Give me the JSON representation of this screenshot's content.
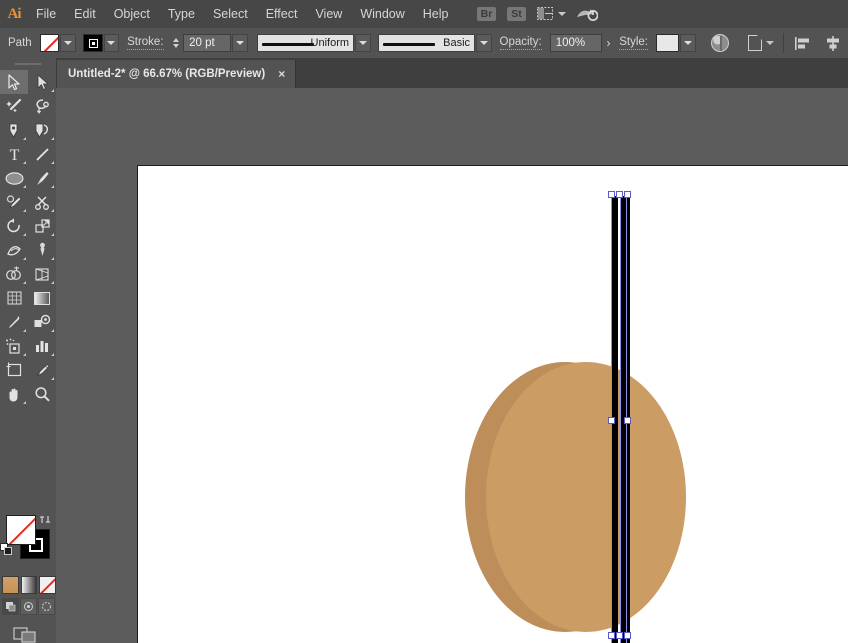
{
  "app": {
    "name": "Adobe Illustrator",
    "logo_text": "Ai"
  },
  "menubar": {
    "items": [
      {
        "label": "File",
        "name": "menu-file"
      },
      {
        "label": "Edit",
        "name": "menu-edit"
      },
      {
        "label": "Object",
        "name": "menu-object"
      },
      {
        "label": "Type",
        "name": "menu-type"
      },
      {
        "label": "Select",
        "name": "menu-select"
      },
      {
        "label": "Effect",
        "name": "menu-effect"
      },
      {
        "label": "View",
        "name": "menu-view"
      },
      {
        "label": "Window",
        "name": "menu-window"
      },
      {
        "label": "Help",
        "name": "menu-help"
      }
    ],
    "bridge_label": "Br",
    "stock_label": "St",
    "arrange_icon": "arrange-documents-icon",
    "sync_icon": "cloud-sync-icon"
  },
  "controlbar": {
    "selection_label": "Path",
    "fill_swatch": "none",
    "stroke_swatch": "black-square",
    "stroke_label": "Stroke:",
    "stroke_weight": "20 pt",
    "width_profile": "Uniform",
    "brush_definition": "Basic",
    "opacity_label": "Opacity:",
    "opacity_value": "100%",
    "style_label": "Style:",
    "style_swatch": "white",
    "recolor_icon": "recolor-artwork-icon",
    "transform_icon": "transform-icon",
    "align_left_icon": "align-horizontal-left-icon",
    "align_center_icon": "align-horizontal-center-icon"
  },
  "document": {
    "tab_title": "Untitled-2* @ 66.67% (RGB/Preview)",
    "close_label": "×",
    "zoom_level": "66.67%",
    "color_mode": "RGB",
    "view_mode": "Preview",
    "modified": true
  },
  "toolbar": {
    "tools": [
      {
        "name": "selection-tool",
        "label": "Selection Tool",
        "active": true,
        "corner": false
      },
      {
        "name": "direct-selection-tool",
        "label": "Direct Selection Tool",
        "active": false,
        "corner": true
      },
      {
        "name": "magic-wand-tool",
        "label": "Magic Wand Tool",
        "active": false,
        "corner": false
      },
      {
        "name": "lasso-tool",
        "label": "Lasso Tool",
        "active": false,
        "corner": false
      },
      {
        "name": "pen-tool",
        "label": "Pen Tool",
        "active": false,
        "corner": true
      },
      {
        "name": "curvature-tool",
        "label": "Curvature Tool",
        "active": false,
        "corner": true
      },
      {
        "name": "type-tool",
        "label": "Type Tool",
        "active": false,
        "corner": true
      },
      {
        "name": "line-segment-tool",
        "label": "Line Segment Tool",
        "active": false,
        "corner": true
      },
      {
        "name": "ellipse-tool",
        "label": "Ellipse Tool",
        "active": false,
        "corner": true
      },
      {
        "name": "paintbrush-tool",
        "label": "Paintbrush Tool",
        "active": false,
        "corner": true
      },
      {
        "name": "shaper-tool",
        "label": "Shaper Tool",
        "active": false,
        "corner": true
      },
      {
        "name": "scissors-tool",
        "label": "Scissors Tool",
        "active": false,
        "corner": true
      },
      {
        "name": "rotate-tool",
        "label": "Rotate Tool",
        "active": false,
        "corner": true
      },
      {
        "name": "scale-tool",
        "label": "Scale Tool",
        "active": false,
        "corner": true
      },
      {
        "name": "width-tool",
        "label": "Width Tool",
        "active": false,
        "corner": true
      },
      {
        "name": "free-transform-tool",
        "label": "Puppet Warp Tool",
        "active": false,
        "corner": true
      },
      {
        "name": "shape-builder-tool",
        "label": "Shape Builder Tool",
        "active": false,
        "corner": true
      },
      {
        "name": "perspective-grid-tool",
        "label": "Perspective Grid Tool",
        "active": false,
        "corner": true
      },
      {
        "name": "mesh-tool",
        "label": "Mesh Tool",
        "active": false,
        "corner": false
      },
      {
        "name": "gradient-tool",
        "label": "Gradient Tool",
        "active": false,
        "corner": false
      },
      {
        "name": "eyedropper-tool",
        "label": "Eyedropper Tool",
        "active": false,
        "corner": true
      },
      {
        "name": "blend-tool",
        "label": "Blend Tool",
        "active": false,
        "corner": true
      },
      {
        "name": "symbol-sprayer-tool",
        "label": "Symbol Sprayer Tool",
        "active": false,
        "corner": true
      },
      {
        "name": "column-graph-tool",
        "label": "Column Graph Tool",
        "active": false,
        "corner": true
      },
      {
        "name": "artboard-tool",
        "label": "Artboard Tool",
        "active": false,
        "corner": false
      },
      {
        "name": "slice-tool",
        "label": "Slice Tool",
        "active": false,
        "corner": true
      },
      {
        "name": "hand-tool",
        "label": "Hand Tool",
        "active": false,
        "corner": true
      },
      {
        "name": "zoom-tool",
        "label": "Zoom Tool",
        "active": false,
        "corner": false
      }
    ],
    "fill_label": "Fill: None",
    "stroke_label": "Stroke: Black",
    "swap_label": "Swap Fill and Stroke",
    "default_label": "Default Fill and Stroke",
    "color_mode_label": "Color",
    "gradient_mode_label": "Gradient",
    "none_mode_label": "None",
    "draw_normal_label": "Draw Normal",
    "draw_behind_label": "Draw Behind",
    "draw_inside_label": "Draw Inside",
    "screen_mode_label": "Change Screen Mode"
  },
  "artwork": {
    "ellipse_fill": "#cb9c64",
    "ellipse_shadow_fill": "#bd8e59",
    "path_stroke": "#000000",
    "selection_color": "#8f8fe8",
    "anchor_fill": "#ffffff",
    "selected_object": "Path",
    "objects": [
      {
        "name": "ellipse-shape",
        "type": "ellipse",
        "fill": "#cb9c64"
      },
      {
        "name": "ellipse-shadow-shape",
        "type": "ellipse",
        "fill": "#bd8e59"
      },
      {
        "name": "vertical-path",
        "type": "path",
        "stroke": "#000000",
        "stroke_weight": "20 pt",
        "selected": true
      }
    ]
  },
  "canvas": {
    "background": "#5c5c5c",
    "artboard_background": "#ffffff"
  }
}
